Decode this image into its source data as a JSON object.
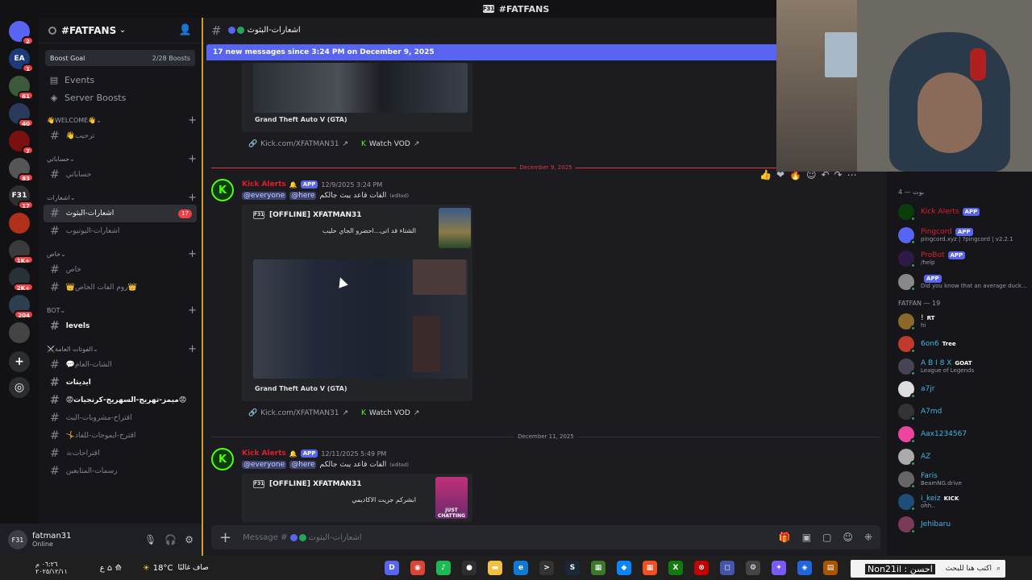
{
  "window": {
    "title": "#FATFANS"
  },
  "servers": [
    {
      "label": "",
      "badge": "2",
      "color": "#5865f2",
      "icon": "discord-icon"
    },
    {
      "label": "EA",
      "badge": "1",
      "color": "#1c3b7a"
    },
    {
      "label": "",
      "badge": "61",
      "color": "#3a5a3a"
    },
    {
      "label": "",
      "badge": "40",
      "color": "#2b3a5c"
    },
    {
      "label": "",
      "badge": "7",
      "color": "#7a1010"
    },
    {
      "label": "",
      "badge": "83",
      "color": "#555"
    },
    {
      "label": "F31",
      "badge": "17",
      "color": "#2e2e33"
    },
    {
      "label": "",
      "badge": "",
      "color": "#b0301c"
    },
    {
      "label": "",
      "badge": "1K+",
      "color": "#3a3a3a"
    },
    {
      "label": "",
      "badge": "2K+",
      "color": "#263238"
    },
    {
      "label": "",
      "badge": "204",
      "color": "#2c3e50"
    },
    {
      "label": "",
      "badge": "",
      "color": "#444"
    }
  ],
  "guild": {
    "name": "#FATFANS",
    "boost_label": "Boost Goal",
    "boost_value": "2/28 Boosts"
  },
  "nav": {
    "events": "Events",
    "server_boosts": "Server Boosts"
  },
  "categories": [
    {
      "name": "👋WELCOME👋",
      "channels": [
        {
          "label": "👋ترحيب"
        }
      ]
    },
    {
      "name": "حساباتي",
      "channels": [
        {
          "label": "حساباتي"
        }
      ]
    },
    {
      "name": "اشعارات",
      "channels": [
        {
          "label": "اشعارات-البثوث",
          "count": "17",
          "active": true
        },
        {
          "label": "اشعارات-اليوتيوب"
        }
      ]
    },
    {
      "name": "خاص",
      "channels": [
        {
          "label": "خاص"
        },
        {
          "label": "👑روم الفات الخاص👑"
        }
      ]
    },
    {
      "name": "BOT",
      "channels": [
        {
          "label": "levels",
          "bright": true
        }
      ]
    },
    {
      "name": "⚔️الفوتات العامة",
      "channels": [
        {
          "label": "💬الشات-العام"
        },
        {
          "label": "ايديتات",
          "bright": true
        },
        {
          "label": "😡ميمز-تهريج-السهريج-كرنجيات😡",
          "bright": true
        },
        {
          "label": "اقتراح-مشروبات-البث"
        },
        {
          "label": "🤸اقترح-ايموجات-للفاد"
        },
        {
          "label": "☕اقتراحات"
        },
        {
          "label": "رسمات-المتابعين"
        }
      ]
    }
  ],
  "user": {
    "name": "fatman31",
    "status": "Online",
    "avatar_label": "F31"
  },
  "chat": {
    "channel_name": "اشعارات-البثوث",
    "new_messages": "17 new messages since 3:24 PM on December 9, 2025",
    "composer_placeholder": "Message #",
    "game": "Grand Theft Auto V (GTA)",
    "link": "Kick.com/XFATMAN31",
    "watch": "Watch VOD",
    "embed_title": "[OFFLINE] XFATMAN31",
    "messages": [
      {
        "author": "Kick Alerts",
        "tag": "APP",
        "time": "12/9/2025 3:24 PM",
        "mention1": "@everyone",
        "mention2": "@here",
        "text": "الفات قاعد يبث جالكم",
        "edited": "(edited)",
        "desc": "الشتاء قد اتى...احضرو الجاي حليب"
      },
      {
        "author": "Kick Alerts",
        "tag": "APP",
        "time": "12/11/2025 5:49 PM",
        "mention1": "@everyone",
        "mention2": "@here",
        "text": "الفات قاعد يبث جالكم",
        "edited": "(edited)",
        "desc": "ابشركم جريت الاكاديمي"
      }
    ],
    "dividers": {
      "first": "December 9, 2025",
      "second": "December 11, 2025"
    },
    "just_chatting": "JUST CHATTING"
  },
  "members": {
    "bots_header": "بوت — 4",
    "bots": [
      {
        "name": "Kick Alerts",
        "tag": "APP",
        "sub": "",
        "color": "#e01e2b",
        "av": "#0b3d0b"
      },
      {
        "name": "Pingcord",
        "tag": "APP",
        "sub": "pingcord.xyz | ?pingcord | v2.2.1",
        "color": "#e01e2b",
        "av": "#5865f2"
      },
      {
        "name": "ProBot",
        "tag": "APP",
        "sub": "/help",
        "color": "#e01e2b",
        "av": "#2e1a47"
      },
      {
        "name": "",
        "tag": "APP",
        "sub": "Did you know that an average duck...",
        "color": "#e01e2b",
        "av": "#888"
      }
    ],
    "fatfan_header": "FATFAN — 19",
    "fatfans": [
      {
        "name": "!",
        "tag": "RT",
        "sub": "hi",
        "color": "#f2f3f5",
        "av": "#8a6a2a"
      },
      {
        "name": "6on6",
        "tag": "Tree",
        "sub": "",
        "color": "#3fb6e0",
        "av": "#c0392b"
      },
      {
        "name": "A B I 8 X",
        "tag": "GOAT",
        "sub": "League of Legends",
        "color": "#3fb6e0",
        "av": "#445"
      },
      {
        "name": "a7jr",
        "tag": "",
        "sub": "",
        "color": "#3fb6e0",
        "av": "#ddd"
      },
      {
        "name": "A7md",
        "tag": "",
        "sub": "",
        "color": "#3fb6e0",
        "av": "#333"
      },
      {
        "name": "Aax1234567",
        "tag": "",
        "sub": "",
        "color": "#3fb6e0",
        "av": "#eb459e"
      },
      {
        "name": "AZ",
        "tag": "",
        "sub": "",
        "color": "#3fb6e0",
        "av": "#aaa"
      },
      {
        "name": "Faris",
        "tag": "",
        "sub": "BeamNG.drive",
        "color": "#3fb6e0",
        "av": "#666"
      },
      {
        "name": "i_keiz",
        "tag": "KICK",
        "sub": "ohh..",
        "color": "#3fb6e0",
        "av": "#1e4d7a"
      },
      {
        "name": "Jehibaru",
        "tag": "",
        "sub": "",
        "color": "#3fb6e0",
        "av": "#7a3a5a"
      }
    ]
  },
  "taskbar": {
    "weather": "18°C",
    "weather_text": "صاف غالبًا",
    "search": "اكتب هنا للبحث",
    "time": "٠٦:٢٦ م",
    "date": "٢٠٢٥/١٢/١١",
    "search_overlay": "Non21il : احسن"
  }
}
